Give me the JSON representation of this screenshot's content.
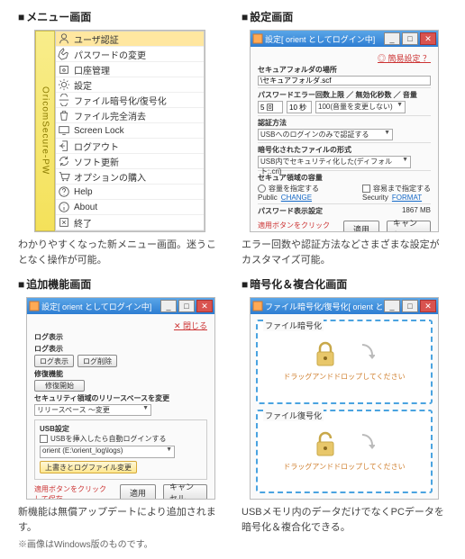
{
  "sections": {
    "menu": {
      "title": "メニュー画面",
      "sidebar_label": "OricomSecure-PW",
      "items": [
        {
          "icon": "user",
          "label": "ユーザ認証"
        },
        {
          "icon": "hand",
          "label": "パスワードの変更"
        },
        {
          "icon": "safe",
          "label": "口座管理"
        },
        {
          "icon": "gear",
          "label": "設定"
        },
        {
          "icon": "loop",
          "label": "ファイル暗号化/復号化"
        },
        {
          "icon": "trash",
          "label": "ファイル完全消去"
        },
        {
          "icon": "monitor",
          "label": "Screen Lock"
        },
        {
          "icon": "logout",
          "label": "ログアウト"
        },
        {
          "icon": "update",
          "label": "ソフト更新"
        },
        {
          "icon": "cart",
          "label": "オプションの購入"
        },
        {
          "icon": "help",
          "label": "Help"
        },
        {
          "icon": "info",
          "label": "About"
        },
        {
          "icon": "exit",
          "label": "終了"
        }
      ],
      "caption": "わかりやすくなった新メニュー画面。迷うことなく操作が可能。"
    },
    "settings": {
      "title": "設定画面",
      "window_title": "設定[ orient としてログイン中]",
      "top_link": "◎ 簡易設定 ？",
      "secure_folder": {
        "label": "セキュアフォルダの場所",
        "value": "\\セキュアフォルダ.scf"
      },
      "pw_group": "パスワードエラー回数上限 ／ 無効化秒数 ／ 音量",
      "retry": "5 回",
      "timeout": "10 秒",
      "volume_select": "100(音量を変更しない)",
      "auth_label": "認証方法",
      "auth_select": "USBへのログインのみで認証する",
      "enc_label": "暗号化されたファイルの形式",
      "enc_select": "USB内でセキュリティ化した(ディフォルト:.cri)",
      "secdom_label": "セキュア領域の容量",
      "secdom_left": {
        "radio": "容量を指定する",
        "sub": "Public",
        "link": "CHANGE"
      },
      "secdom_right": {
        "check": "容易まで指定する",
        "sub": "Security",
        "link": "FORMAT"
      },
      "pwdisp_label": "パスワード表示設定",
      "pwdisp_value": "1867 MB",
      "footer_note": "適用ボタンをクリックして保存",
      "btn_apply": "適用",
      "btn_cancel": "キャンセル",
      "caption": "エラー回数や認証方法などさまざまな設定がカスタマイズ可能。"
    },
    "extra": {
      "title": "追加機能画面",
      "window_title": "設定[ orient としてログイン中]",
      "top_link": "✕ 閉じる",
      "loglabel": "ログ表示",
      "logbtn1": "ログ表示",
      "logbtn2": "ログ削除",
      "restore_label": "修復機能",
      "restore_btn": "修復開始",
      "release_label": "セキュリティ領域のリリースベースを変更",
      "release_select": "リリースペース ～変更",
      "usb_label": "USB設定",
      "usb_check": "USBを挿入したら自動ログインする",
      "usb_select": "orient (E:\\orient_log\\logs)",
      "usb_btn": "上書きとログファイル変更",
      "footer_note": "適用ボタンをクリックして保存",
      "btn_apply": "適用",
      "btn_cancel": "キャンセル",
      "caption": "新機能は無償アップデートにより追加されます。",
      "subcaption": "※画像はWindows版のものです。"
    },
    "crypto": {
      "title": "暗号化＆複合化画面",
      "window_title": "ファイル暗号化/復号化[ orient としてログ…",
      "zone1": {
        "label": "ファイル暗号化",
        "hint": "ドラッグアンドドロップしてください"
      },
      "zone2": {
        "label": "ファイル復号化",
        "hint": "ドラッグアンドドロップしてください"
      },
      "caption": "USBメモリ内のデータだけでなくPCデータを暗号化＆複合化できる。"
    }
  }
}
